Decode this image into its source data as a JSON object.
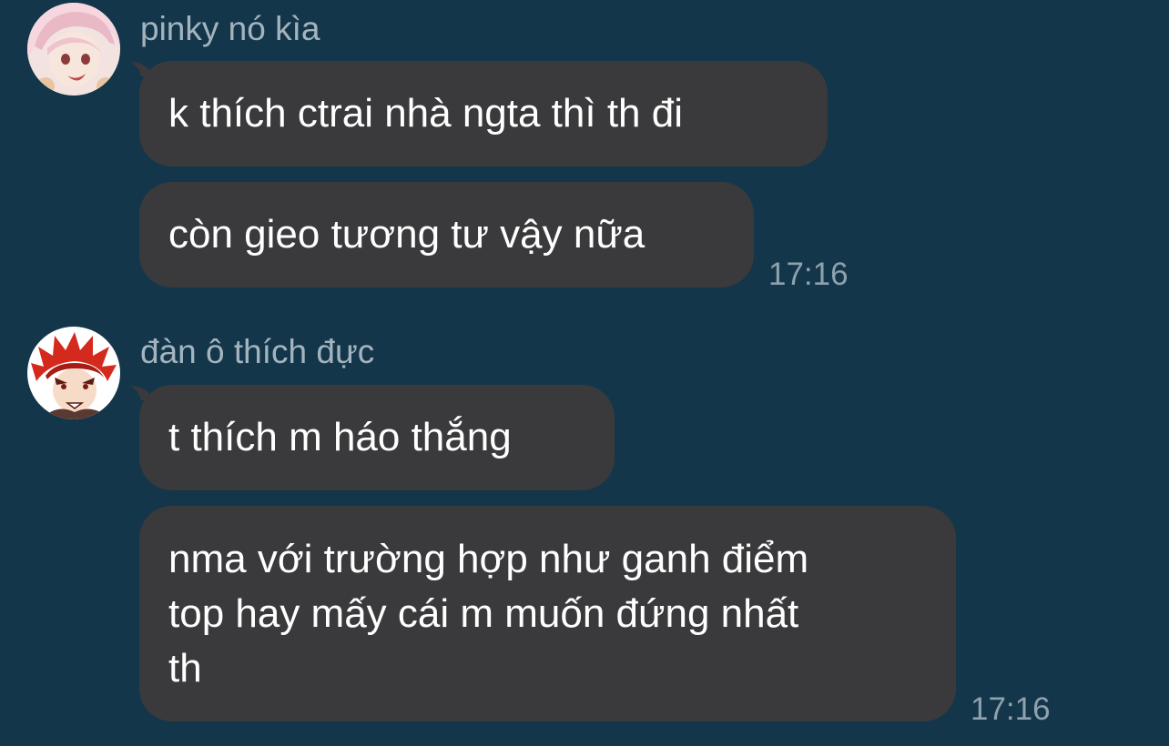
{
  "colors": {
    "background": "#14364a",
    "bubble": "#3a3a3c",
    "sender_name": "#a4b4bf",
    "timestamp": "#8ea1ad"
  },
  "groups": [
    {
      "sender": "pinky nó kìa",
      "avatar_icon": "pink-haired-anime-avatar-icon",
      "messages": [
        "k thích ctrai nhà ngta thì th đi",
        "còn gieo tương tư vậy nữa"
      ],
      "time": "17:16"
    },
    {
      "sender": "đàn ô thích đực",
      "avatar_icon": "red-spiky-haired-anime-avatar-icon",
      "messages": [
        "t thích m háo thắng",
        "nma với trường hợp như ganh điểm\ntop hay mấy cái m muốn đứng nhất\nth"
      ],
      "time": "17:16"
    }
  ]
}
